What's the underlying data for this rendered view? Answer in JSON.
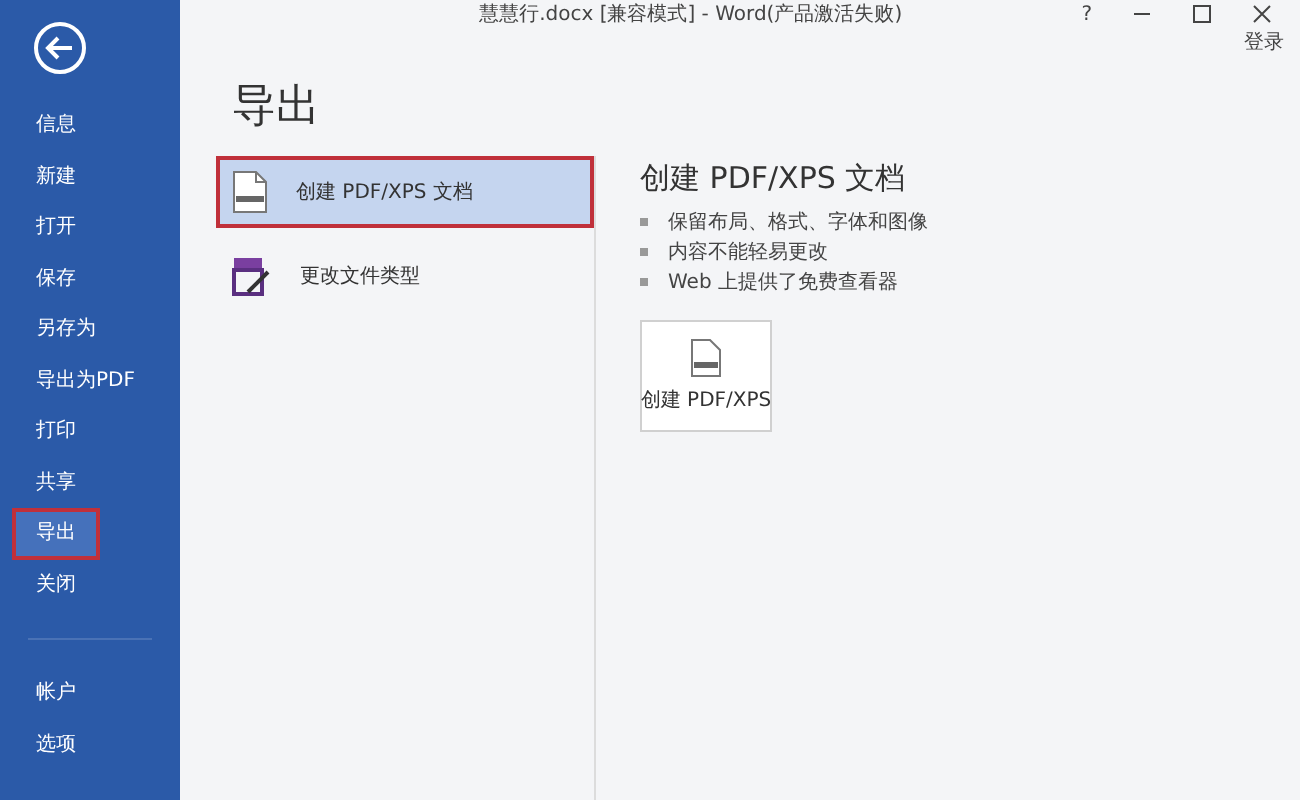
{
  "window": {
    "title": "慧慧行.docx [兼容模式] - Word(产品激活失败)",
    "help": "?",
    "sign_in": "登录"
  },
  "sidebar": {
    "items": [
      {
        "label": "信息",
        "selected": false,
        "outlined": false
      },
      {
        "label": "新建",
        "selected": false,
        "outlined": false
      },
      {
        "label": "打开",
        "selected": false,
        "outlined": false
      },
      {
        "label": "保存",
        "selected": false,
        "outlined": false
      },
      {
        "label": "另存为",
        "selected": false,
        "outlined": false
      },
      {
        "label": "导出为PDF",
        "selected": false,
        "outlined": false
      },
      {
        "label": "打印",
        "selected": false,
        "outlined": false
      },
      {
        "label": "共享",
        "selected": false,
        "outlined": false
      },
      {
        "label": "导出",
        "selected": true,
        "outlined": true
      },
      {
        "label": "关闭",
        "selected": false,
        "outlined": false
      }
    ],
    "bottom_items": [
      {
        "label": "帐户",
        "selected": false
      },
      {
        "label": "选项",
        "selected": false
      }
    ]
  },
  "heading": "导出",
  "options": [
    {
      "label": "创建 PDF/XPS 文档",
      "kind": "pdf",
      "selected": true,
      "outlined": true
    },
    {
      "label": "更改文件类型",
      "kind": "filetype",
      "selected": false,
      "outlined": false
    }
  ],
  "detail": {
    "title": "创建 PDF/XPS 文档",
    "bullets": [
      "保留布局、格式、字体和图像",
      "内容不能轻易更改",
      "Web 上提供了免费查看器"
    ],
    "button": "创建 PDF/XPS"
  }
}
